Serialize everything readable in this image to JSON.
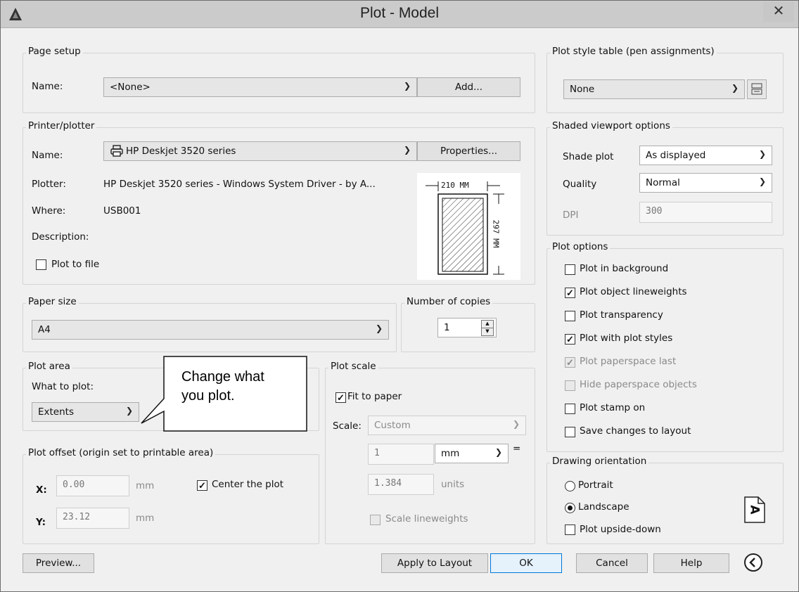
{
  "window": {
    "title": "Plot - Model",
    "close_glyph": "✕"
  },
  "page_setup": {
    "legend": "Page setup",
    "name_label": "Name:",
    "name_value": "<None>",
    "add_button": "Add..."
  },
  "printer": {
    "legend": "Printer/plotter",
    "name_label": "Name:",
    "name_value": "HP Deskjet 3520 series",
    "properties_button": "Properties...",
    "plotter_label": "Plotter:",
    "plotter_value": "HP Deskjet 3520 series - Windows System Driver - by A...",
    "where_label": "Where:",
    "where_value": "USB001",
    "description_label": "Description:",
    "plot_to_file_label": "Plot to file",
    "plot_to_file_checked": false,
    "preview_width_label": "210 MM",
    "preview_height_label": "297 MM"
  },
  "paper_size": {
    "legend": "Paper size",
    "value": "A4"
  },
  "copies": {
    "legend": "Number of copies",
    "value": "1"
  },
  "plot_area": {
    "legend": "Plot area",
    "what_label": "What to plot:",
    "what_value": "Extents"
  },
  "callout": {
    "line1": "Change what",
    "line2": "you plot."
  },
  "plot_offset": {
    "legend": "Plot offset (origin set to printable area)",
    "x_label": "X:",
    "x_value": "0.00",
    "x_unit": "mm",
    "y_label": "Y:",
    "y_value": "23.12",
    "y_unit": "mm",
    "center_label": "Center the plot",
    "center_checked": true
  },
  "plot_scale": {
    "legend": "Plot scale",
    "fit_label": "Fit to paper",
    "fit_checked": true,
    "scale_label": "Scale:",
    "scale_value": "Custom",
    "value1": "1",
    "unit1": "mm",
    "equals": "=",
    "value2": "1.384",
    "unit2": "units",
    "lineweights_label": "Scale lineweights"
  },
  "pen": {
    "legend": "Plot style table (pen assignments)",
    "value": "None"
  },
  "shaded": {
    "legend": "Shaded viewport options",
    "shade_label": "Shade plot",
    "shade_value": "As displayed",
    "quality_label": "Quality",
    "quality_value": "Normal",
    "dpi_label": "DPI",
    "dpi_value": "300"
  },
  "plot_options": {
    "legend": "Plot options",
    "items": [
      {
        "label": "Plot in background",
        "checked": false,
        "disabled": false
      },
      {
        "label": "Plot object lineweights",
        "checked": true,
        "disabled": false
      },
      {
        "label": "Plot transparency",
        "checked": false,
        "disabled": false
      },
      {
        "label": "Plot with plot styles",
        "checked": true,
        "disabled": false
      },
      {
        "label": "Plot paperspace last",
        "checked": true,
        "disabled": true
      },
      {
        "label": "Hide paperspace objects",
        "checked": false,
        "disabled": true
      },
      {
        "label": "Plot stamp on",
        "checked": false,
        "disabled": false
      },
      {
        "label": "Save changes to layout",
        "checked": false,
        "disabled": false
      }
    ]
  },
  "orientation": {
    "legend": "Drawing orientation",
    "portrait": "Portrait",
    "landscape": "Landscape",
    "selected": "Landscape",
    "upside_down": "Plot upside-down",
    "icon_letter": "A"
  },
  "footer": {
    "preview": "Preview...",
    "apply": "Apply to Layout",
    "ok": "OK",
    "cancel": "Cancel",
    "help": "Help"
  }
}
